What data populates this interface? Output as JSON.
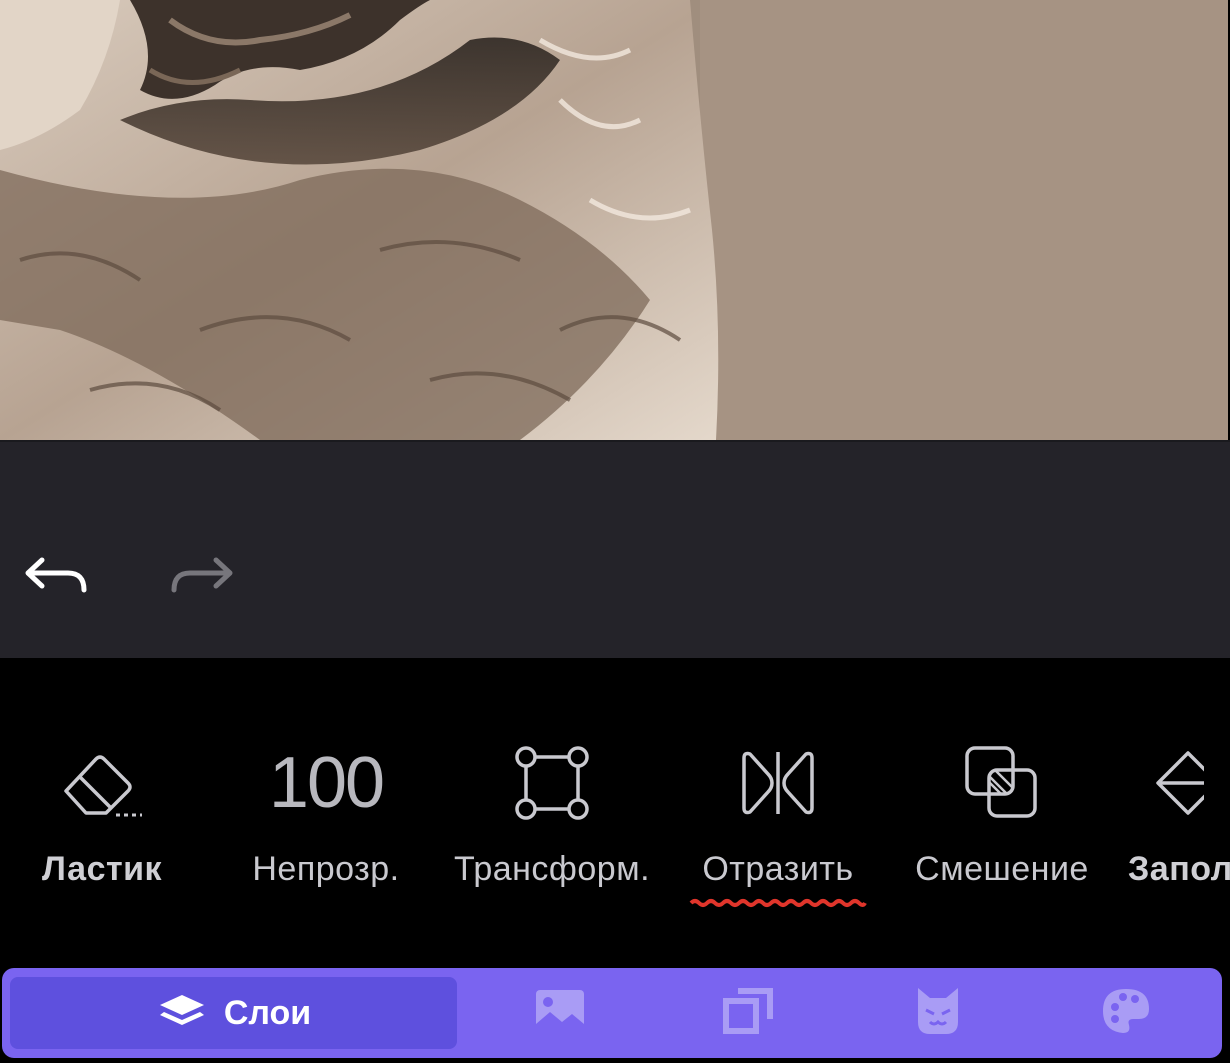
{
  "canvas": {
    "image_subject": "marble-sculpture-photo"
  },
  "history": {
    "undo_icon": "undo-arrow-icon",
    "redo_icon": "redo-arrow-icon"
  },
  "tools": [
    {
      "id": "eraser",
      "label": "Ластик",
      "icon": "eraser-icon",
      "bold": true
    },
    {
      "id": "opacity",
      "label": "Непрозр.",
      "value": "100"
    },
    {
      "id": "transform",
      "label": "Трансформ.",
      "icon": "transform-icon"
    },
    {
      "id": "flip",
      "label": "Отразить",
      "icon": "flip-icon",
      "spellcheck_marked": true
    },
    {
      "id": "blend",
      "label": "Смешение",
      "icon": "blend-icon"
    },
    {
      "id": "fill",
      "label": "Запол",
      "icon": "fill-bucket-icon",
      "bold": true
    }
  ],
  "tabs": [
    {
      "id": "layers",
      "label": "Слои",
      "icon": "layers-icon",
      "active": true
    },
    {
      "id": "image",
      "icon": "image-icon"
    },
    {
      "id": "resize",
      "icon": "resize-icon"
    },
    {
      "id": "stickers",
      "icon": "cat-icon"
    },
    {
      "id": "palette",
      "icon": "palette-icon"
    }
  ],
  "colors": {
    "accent": "#7a64f0",
    "accent_active": "#5e50de",
    "history_bg": "#242329",
    "tools_bg": "#000000",
    "spellcheck_underline": "#e0352b"
  }
}
